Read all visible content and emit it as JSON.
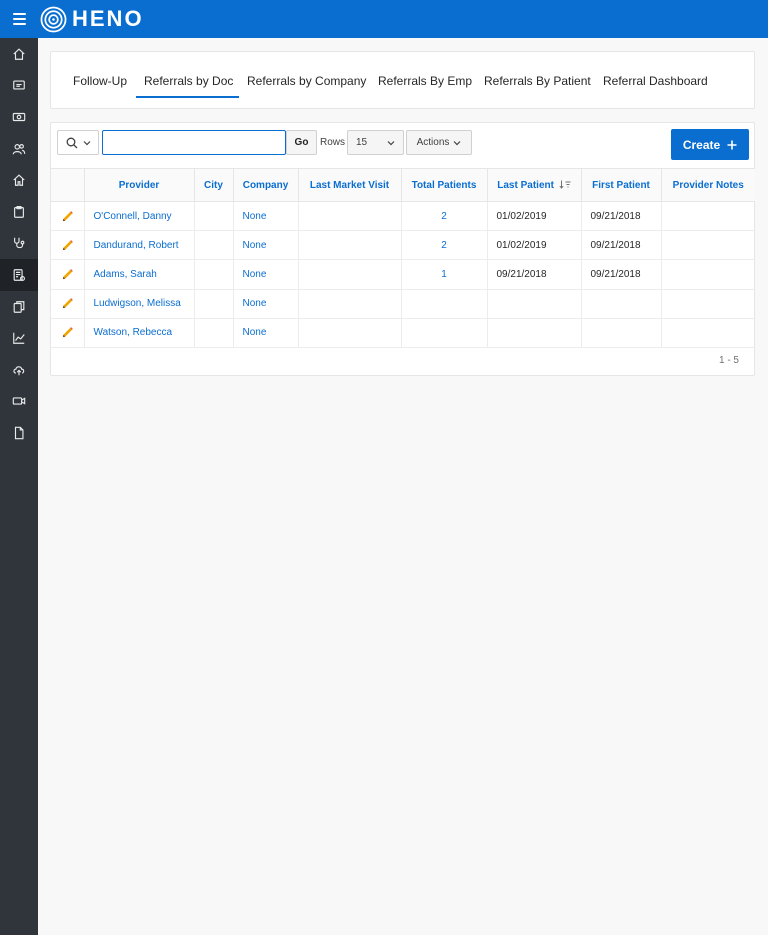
{
  "app": {
    "name": "HENO"
  },
  "sidebar": {
    "items": [
      {
        "icon": "home-icon"
      },
      {
        "icon": "id-card-icon"
      },
      {
        "icon": "money-icon"
      },
      {
        "icon": "users-icon"
      },
      {
        "icon": "house-icon"
      },
      {
        "icon": "clipboard-icon"
      },
      {
        "icon": "stethoscope-icon"
      },
      {
        "icon": "referral-form-icon",
        "active": true
      },
      {
        "icon": "documents-icon"
      },
      {
        "icon": "line-chart-icon"
      },
      {
        "icon": "cloud-upload-icon"
      },
      {
        "icon": "video-icon"
      },
      {
        "icon": "file-icon"
      }
    ]
  },
  "tabs": [
    {
      "label": "Follow-Up"
    },
    {
      "label": "Referrals by Doc",
      "active": true
    },
    {
      "label": "Referrals by Company"
    },
    {
      "label": "Referrals By Emp"
    },
    {
      "label": "Referrals By Patient"
    },
    {
      "label": "Referral Dashboard"
    }
  ],
  "toolbar": {
    "search_value": "",
    "go_label": "Go",
    "rows_label": "Rows",
    "rows_value": "15",
    "actions_label": "Actions",
    "create_label": "Create"
  },
  "table": {
    "columns": [
      "Provider",
      "City",
      "Company",
      "Last Market Visit",
      "Total Patients",
      "Last Patient",
      "First Patient",
      "Provider Notes"
    ],
    "sorted_column": "Last Patient",
    "rows": [
      {
        "provider": "O'Connell, Danny",
        "city": "",
        "company": "None",
        "last_market_visit": "",
        "total_patients": "2",
        "last_patient": "01/02/2019",
        "first_patient": "09/21/2018",
        "provider_notes": ""
      },
      {
        "provider": "Dandurand, Robert",
        "city": "",
        "company": "None",
        "last_market_visit": "",
        "total_patients": "2",
        "last_patient": "01/02/2019",
        "first_patient": "09/21/2018",
        "provider_notes": ""
      },
      {
        "provider": "Adams, Sarah",
        "city": "",
        "company": "None",
        "last_market_visit": "",
        "total_patients": "1",
        "last_patient": "09/21/2018",
        "first_patient": "09/21/2018",
        "provider_notes": ""
      },
      {
        "provider": "Ludwigson, Melissa",
        "city": "",
        "company": "None",
        "last_market_visit": "",
        "total_patients": "",
        "last_patient": "",
        "first_patient": "",
        "provider_notes": ""
      },
      {
        "provider": "Watson, Rebecca",
        "city": "",
        "company": "None",
        "last_market_visit": "",
        "total_patients": "",
        "last_patient": "",
        "first_patient": "",
        "provider_notes": ""
      }
    ]
  },
  "pagination": "1 - 5",
  "colors": {
    "brand": "#0a6ed1",
    "sidebar": "#2f353a",
    "edit_icon": "#f0a500"
  }
}
